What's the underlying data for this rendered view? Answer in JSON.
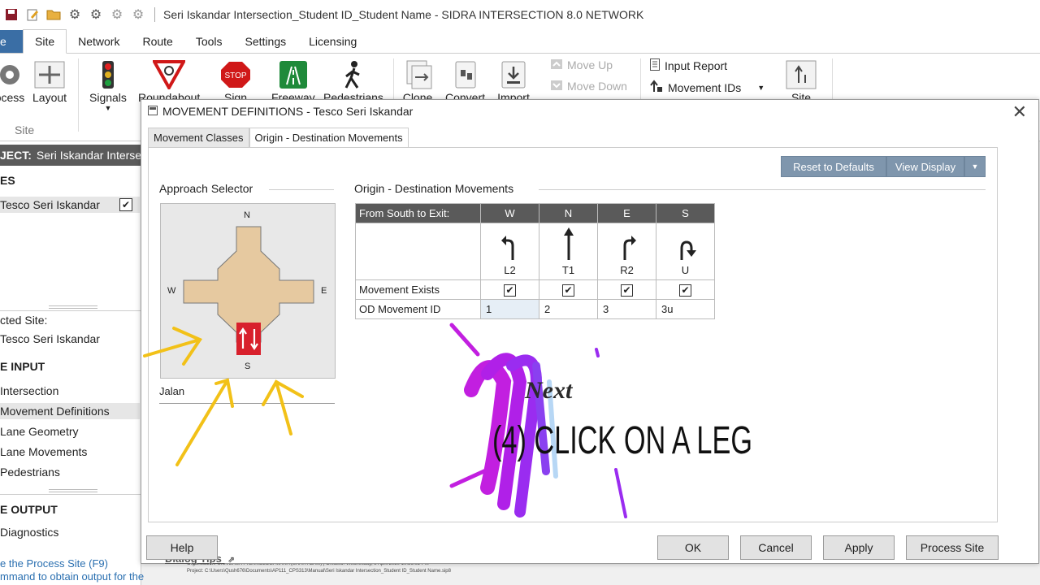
{
  "window": {
    "title": "Seri Iskandar Intersection_Student ID_Student Name - SIDRA INTERSECTION 8.0 NETWORK"
  },
  "ribbon": {
    "tabs": [
      "e",
      "Site",
      "Network",
      "Route",
      "Tools",
      "Settings",
      "Licensing"
    ],
    "buttons": {
      "process": "ocess",
      "layout": "Layout",
      "signals": "Signals",
      "roundabout": "Roundabout",
      "sign": "Sign",
      "freeway": "Freeway",
      "pedestrians": "Pedestrians",
      "clone": "Clone",
      "convert": "Convert",
      "import": "Import",
      "move_up": "Move Up",
      "move_down": "Move Down",
      "input_report": "Input Report",
      "movement_ids": "Movement IDs",
      "site_btn": "Site"
    },
    "group_site": "Site"
  },
  "left_panel": {
    "project_label": "JECT:",
    "project_name": "Seri Iskandar Interse",
    "sites_head": "ES",
    "site_item": "Tesco Seri Iskandar",
    "selected_label": "cted Site:",
    "selected_value": "Tesco Seri Iskandar",
    "input_head": "E INPUT",
    "input_items": [
      "Intersection",
      "Movement Definitions",
      "Lane Geometry",
      "Lane Movements",
      "Pedestrians"
    ],
    "output_head": "E OUTPUT",
    "output_items": [
      "Diagnostics"
    ],
    "hint_line1": "e the Process Site (F9)",
    "hint_line2": "mmand to obtain output for the"
  },
  "footer": {
    "line1": "Organisation: UNIVERSITI TEKNOLOGI MARA (SHAH ALAM) | Created: Wednesday, 8 April 2020 10:36:02 PM",
    "line2": "Project: C:\\Users\\Qush676\\Documents\\AP111_CPS313\\Manual\\Seri Iskandar Intersection_Student ID_Student Name.sip8"
  },
  "dialog": {
    "title": "MOVEMENT DEFINITIONS - Tesco Seri Iskandar",
    "tabs": [
      "Movement Classes",
      "Origin - Destination Movements"
    ],
    "reset_label": "Reset to Defaults",
    "view_display_label": "View Display",
    "approach_title": "Approach Selector",
    "od_title": "Origin - Destination Movements",
    "compass": {
      "n": "N",
      "s": "S",
      "e": "E",
      "w": "W"
    },
    "approach_name": "Jalan",
    "table": {
      "header_label": "From South to Exit:",
      "columns": [
        {
          "exit": "W",
          "code": "L2",
          "id": "1",
          "exists": true,
          "icon": "left-turn-icon"
        },
        {
          "exit": "N",
          "code": "T1",
          "id": "2",
          "exists": true,
          "icon": "through-icon"
        },
        {
          "exit": "E",
          "code": "R2",
          "id": "3",
          "exists": true,
          "icon": "right-turn-icon"
        },
        {
          "exit": "S",
          "code": "U",
          "id": "3u",
          "exists": true,
          "icon": "u-turn-icon"
        }
      ],
      "row_exists": "Movement Exists",
      "row_id": "OD Movement ID"
    },
    "dialog_tips": "Dialog Tips",
    "buttons": {
      "help": "Help",
      "ok": "OK",
      "cancel": "Cancel",
      "apply": "Apply",
      "process": "Process Site"
    }
  },
  "annotation": {
    "next": "Next",
    "step": "(4) CLICK ON A LEG",
    "arrow_color": "#f2c118",
    "scribble_color": "#c21fe0"
  }
}
